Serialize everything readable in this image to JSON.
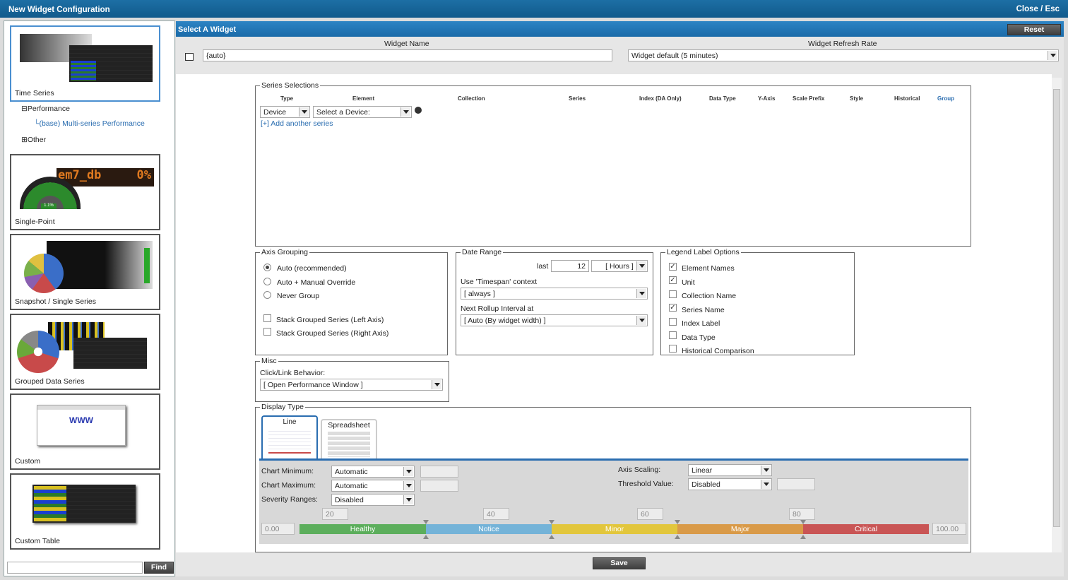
{
  "window": {
    "title": "New Widget Configuration",
    "close": "Close / Esc"
  },
  "sidebar": {
    "cards": [
      {
        "label": "Time Series"
      },
      {
        "label": "Single-Point"
      },
      {
        "label": "Snapshot / Single Series"
      },
      {
        "label": "Grouped Data Series"
      },
      {
        "label": "Custom"
      },
      {
        "label": "Custom Table"
      }
    ],
    "tree": {
      "performance": "Performance",
      "multi": "(base) Multi-series Performance",
      "other": "Other"
    },
    "custom_thumb_text": "WWW",
    "single_thumb_text": "em7_db",
    "single_thumb_value": "0%",
    "gauge_value": "1.1%",
    "search_placeholder": "",
    "find": "Find"
  },
  "main": {
    "header": "Select A Widget",
    "reset": "Reset",
    "widget_name_label": "Widget Name",
    "widget_name_value": "{auto}",
    "refresh_label": "Widget Refresh Rate",
    "refresh_value": "Widget default (5 minutes)",
    "series": {
      "legend": "Series Selections",
      "columns": [
        "Type",
        "Element",
        "Collection",
        "Series",
        "Index (DA Only)",
        "Data Type",
        "Y-Axis",
        "Scale Prefix",
        "Style",
        "Historical",
        "Group"
      ],
      "type_value": "Device",
      "element_value": "Select a Device:",
      "add": "[+] Add another series"
    },
    "axis": {
      "legend": "Axis Grouping",
      "options": [
        "Auto (recommended)",
        "Auto + Manual Override",
        "Never Group"
      ],
      "checks": [
        "Stack Grouped Series (Left Axis)",
        "Stack Grouped Series (Right Axis)"
      ]
    },
    "date": {
      "legend": "Date Range",
      "last": "last",
      "num": "12",
      "unit": "[ Hours ]",
      "timespan_label": "Use 'Timespan' context",
      "timespan_value": "[ always ]",
      "rollup_label": "Next Rollup Interval at",
      "rollup_value": "[ Auto (By widget width) ]"
    },
    "legendopts": {
      "legend": "Legend Label Options",
      "items": [
        {
          "label": "Element Names",
          "checked": true
        },
        {
          "label": "Unit",
          "checked": true
        },
        {
          "label": "Collection Name",
          "checked": false
        },
        {
          "label": "Series Name",
          "checked": true
        },
        {
          "label": "Index Label",
          "checked": false
        },
        {
          "label": "Data Type",
          "checked": false
        },
        {
          "label": "Historical Comparison",
          "checked": false
        }
      ]
    },
    "misc": {
      "legend": "Misc",
      "click_label": "Click/Link Behavior:",
      "click_value": "[ Open Performance Window ]"
    },
    "display": {
      "legend": "Display Type",
      "tabs": [
        "Line",
        "Spreadsheet"
      ],
      "chart_min_label": "Chart Minimum:",
      "chart_min_value": "Automatic",
      "chart_max_label": "Chart Maximum:",
      "chart_max_value": "Automatic",
      "severity_label": "Severity Ranges:",
      "severity_value": "Disabled",
      "axis_scaling_label": "Axis Scaling:",
      "axis_scaling_value": "Linear",
      "threshold_label": "Threshold Value:",
      "threshold_value": "Disabled",
      "markers": [
        "20",
        "40",
        "60",
        "80"
      ],
      "min": "0.00",
      "max": "100.00",
      "ranges": [
        {
          "label": "Healthy",
          "color": "#5cae5c"
        },
        {
          "label": "Notice",
          "color": "#74b3d8"
        },
        {
          "label": "Minor",
          "color": "#e2c63c"
        },
        {
          "label": "Major",
          "color": "#d99a48"
        },
        {
          "label": "Critical",
          "color": "#c95555"
        }
      ]
    },
    "save": "Save"
  }
}
